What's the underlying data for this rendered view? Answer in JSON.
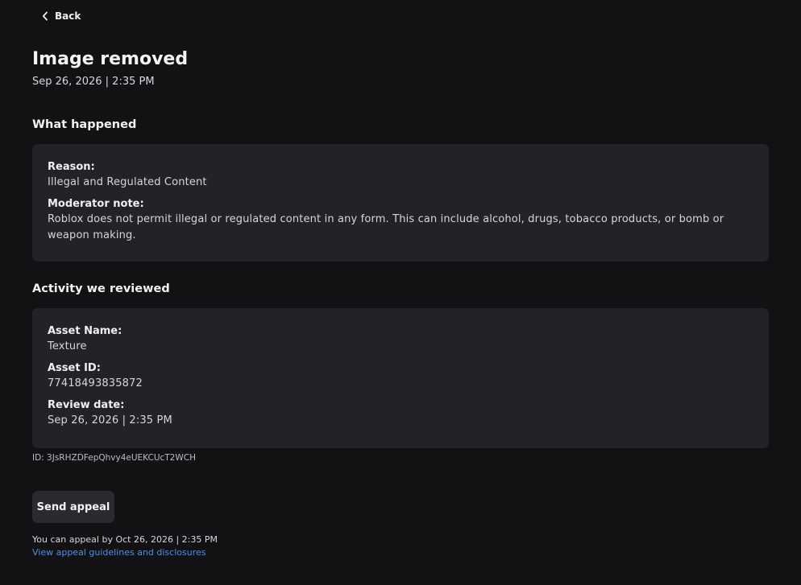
{
  "nav": {
    "back_label": "Back"
  },
  "header": {
    "title": "Image removed",
    "timestamp": "Sep 26, 2026 | 2:35 PM"
  },
  "what_happened": {
    "heading": "What happened",
    "reason_label": "Reason:",
    "reason_value": "Illegal and Regulated Content",
    "note_label": "Moderator note:",
    "note_value": "Roblox does not permit illegal or regulated content in any form. This can include alcohol, drugs, tobacco products, or bomb or weapon making."
  },
  "activity": {
    "heading": "Activity we reviewed",
    "asset_name_label": "Asset Name:",
    "asset_name_value": "Texture",
    "asset_id_label": "Asset ID:",
    "asset_id_value": "77418493835872",
    "review_date_label": "Review date:",
    "review_date_value": "Sep 26, 2026 | 2:35 PM"
  },
  "record": {
    "id_text": "ID: 3JsRHZDFepQhvy4eUEKCUcT2WCH"
  },
  "appeal": {
    "button_label": "Send appeal",
    "deadline_text": "You can appeal by Oct 26, 2026 | 2:35 PM",
    "guidelines_link": "View appeal guidelines and disclosures"
  },
  "colors": {
    "background": "#121215",
    "card": "#222328",
    "button": "#2a2b30",
    "link": "#4e8fe8"
  },
  "icons": {
    "back": "chevron-left-icon"
  }
}
